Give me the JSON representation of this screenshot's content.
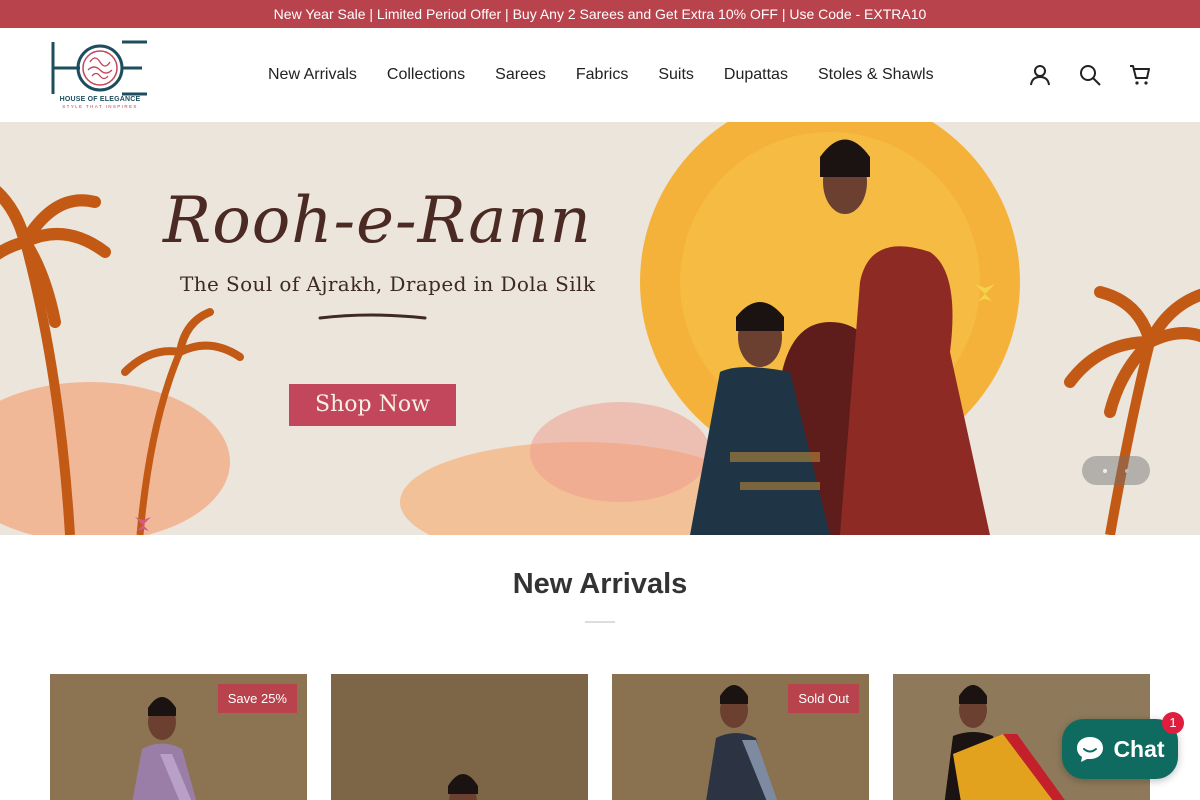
{
  "announcement": "New Year Sale | Limited Period Offer | Buy Any 2 Sarees and Get Extra 10% OFF | Use Code - EXTRA10",
  "logo": {
    "name": "HOUSE OF ELEGANCE",
    "tagline": "STYLE THAT INSPIRES",
    "mark": "HOE"
  },
  "nav": {
    "items": [
      "New Arrivals",
      "Collections",
      "Sarees",
      "Fabrics",
      "Suits",
      "Dupattas",
      "Stoles & Shawls"
    ]
  },
  "header_icons": [
    "account-icon",
    "search-icon",
    "cart-icon"
  ],
  "hero": {
    "title": "Rooh-e-Rann",
    "subtitle": "The Soul of Ajrakh, Draped in Dola Silk",
    "cta": "Shop Now",
    "slide_count": 2,
    "active_slide": 1
  },
  "section": {
    "title": "New Arrivals"
  },
  "products": [
    {
      "badge": "Save 25%",
      "image_colors": [
        "#8c7352",
        "#9a7ea8"
      ]
    },
    {
      "badge": "",
      "image_colors": [
        "#7d6548",
        "#3a2a22"
      ]
    },
    {
      "badge": "Sold Out",
      "image_colors": [
        "#8a7150",
        "#2c3444"
      ]
    },
    {
      "badge": "",
      "image_colors": [
        "#8e7a5b",
        "#e2a21d"
      ]
    }
  ],
  "chat": {
    "label": "Chat",
    "unread": "1"
  },
  "colors": {
    "brand": "#b8434c",
    "brand_teal": "#1c4e5e",
    "chat_green": "#0f6b60"
  }
}
